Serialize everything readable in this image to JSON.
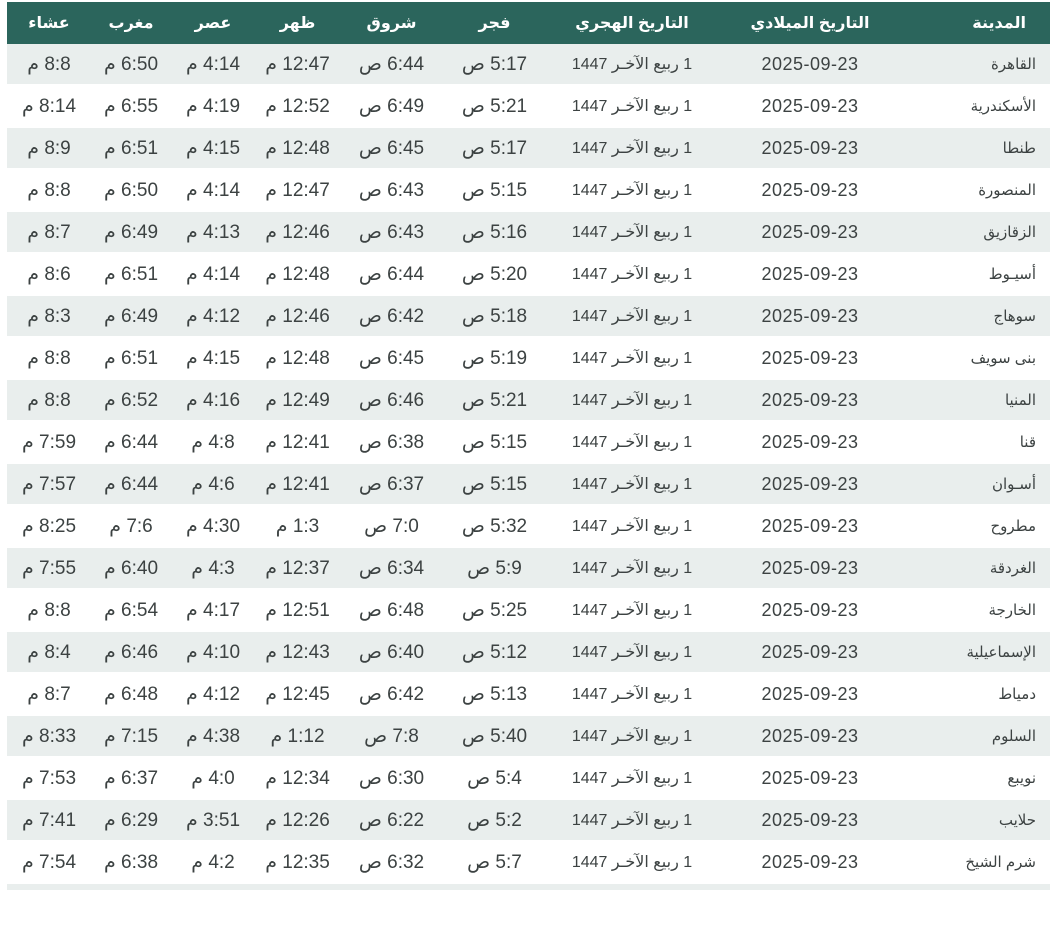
{
  "colors": {
    "header_bg": "#2b655c",
    "header_text": "#ffffff",
    "row_alt_bg": "#e9eeed",
    "row_bg": "#ffffff",
    "text": "#3c4242"
  },
  "table": {
    "field_order": [
      "city",
      "gregorian",
      "hijri",
      "fajr",
      "shuruq",
      "dhuhr",
      "asr",
      "maghrib",
      "isha"
    ],
    "columns": [
      {
        "key": "city",
        "label": "المدينة"
      },
      {
        "key": "gregorian",
        "label": "التاريخ الميلادي"
      },
      {
        "key": "hijri",
        "label": "التاريخ الهجري"
      },
      {
        "key": "fajr",
        "label": "فجر"
      },
      {
        "key": "shuruq",
        "label": "شروق"
      },
      {
        "key": "dhuhr",
        "label": "ظهر"
      },
      {
        "key": "asr",
        "label": "عصر"
      },
      {
        "key": "maghrib",
        "label": "مغرب"
      },
      {
        "key": "isha",
        "label": "عشاء"
      }
    ],
    "rows": [
      {
        "city": "القاهرة",
        "gregorian": "2025-09-23",
        "hijri": "1 ربيع الآخـر 1447",
        "fajr": "5:17 ص",
        "shuruq": "6:44 ص",
        "dhuhr": "12:47 م",
        "asr": "4:14 م",
        "maghrib": "6:50 م",
        "isha": "8:8 م"
      },
      {
        "city": "الأسكندرية",
        "gregorian": "2025-09-23",
        "hijri": "1 ربيع الآخـر 1447",
        "fajr": "5:21 ص",
        "shuruq": "6:49 ص",
        "dhuhr": "12:52 م",
        "asr": "4:19 م",
        "maghrib": "6:55 م",
        "isha": "8:14 م"
      },
      {
        "city": "طنطا",
        "gregorian": "2025-09-23",
        "hijri": "1 ربيع الآخـر 1447",
        "fajr": "5:17 ص",
        "shuruq": "6:45 ص",
        "dhuhr": "12:48 م",
        "asr": "4:15 م",
        "maghrib": "6:51 م",
        "isha": "8:9 م"
      },
      {
        "city": "المنصورة",
        "gregorian": "2025-09-23",
        "hijri": "1 ربيع الآخـر 1447",
        "fajr": "5:15 ص",
        "shuruq": "6:43 ص",
        "dhuhr": "12:47 م",
        "asr": "4:14 م",
        "maghrib": "6:50 م",
        "isha": "8:8 م"
      },
      {
        "city": "الزقازيق",
        "gregorian": "2025-09-23",
        "hijri": "1 ربيع الآخـر 1447",
        "fajr": "5:16 ص",
        "shuruq": "6:43 ص",
        "dhuhr": "12:46 م",
        "asr": "4:13 م",
        "maghrib": "6:49 م",
        "isha": "8:7 م"
      },
      {
        "city": "أسيـوط",
        "gregorian": "2025-09-23",
        "hijri": "1 ربيع الآخـر 1447",
        "fajr": "5:20 ص",
        "shuruq": "6:44 ص",
        "dhuhr": "12:48 م",
        "asr": "4:14 م",
        "maghrib": "6:51 م",
        "isha": "8:6 م"
      },
      {
        "city": "سوهاج",
        "gregorian": "2025-09-23",
        "hijri": "1 ربيع الآخـر 1447",
        "fajr": "5:18 ص",
        "shuruq": "6:42 ص",
        "dhuhr": "12:46 م",
        "asr": "4:12 م",
        "maghrib": "6:49 م",
        "isha": "8:3 م"
      },
      {
        "city": "بنى سويف",
        "gregorian": "2025-09-23",
        "hijri": "1 ربيع الآخـر 1447",
        "fajr": "5:19 ص",
        "shuruq": "6:45 ص",
        "dhuhr": "12:48 م",
        "asr": "4:15 م",
        "maghrib": "6:51 م",
        "isha": "8:8 م"
      },
      {
        "city": "المنيا",
        "gregorian": "2025-09-23",
        "hijri": "1 ربيع الآخـر 1447",
        "fajr": "5:21 ص",
        "shuruq": "6:46 ص",
        "dhuhr": "12:49 م",
        "asr": "4:16 م",
        "maghrib": "6:52 م",
        "isha": "8:8 م"
      },
      {
        "city": "قنا",
        "gregorian": "2025-09-23",
        "hijri": "1 ربيع الآخـر 1447",
        "fajr": "5:15 ص",
        "shuruq": "6:38 ص",
        "dhuhr": "12:41 م",
        "asr": "4:8 م",
        "maghrib": "6:44 م",
        "isha": "7:59 م"
      },
      {
        "city": "أسـوان",
        "gregorian": "2025-09-23",
        "hijri": "1 ربيع الآخـر 1447",
        "fajr": "5:15 ص",
        "shuruq": "6:37 ص",
        "dhuhr": "12:41 م",
        "asr": "4:6 م",
        "maghrib": "6:44 م",
        "isha": "7:57 م"
      },
      {
        "city": "مطروح",
        "gregorian": "2025-09-23",
        "hijri": "1 ربيع الآخـر 1447",
        "fajr": "5:32 ص",
        "shuruq": "7:0 ص",
        "dhuhr": "1:3 م",
        "asr": "4:30 م",
        "maghrib": "7:6 م",
        "isha": "8:25 م"
      },
      {
        "city": "الغردقة",
        "gregorian": "2025-09-23",
        "hijri": "1 ربيع الآخـر 1447",
        "fajr": "5:9 ص",
        "shuruq": "6:34 ص",
        "dhuhr": "12:37 م",
        "asr": "4:3 م",
        "maghrib": "6:40 م",
        "isha": "7:55 م"
      },
      {
        "city": "الخارجة",
        "gregorian": "2025-09-23",
        "hijri": "1 ربيع الآخـر 1447",
        "fajr": "5:25 ص",
        "shuruq": "6:48 ص",
        "dhuhr": "12:51 م",
        "asr": "4:17 م",
        "maghrib": "6:54 م",
        "isha": "8:8 م"
      },
      {
        "city": "الإسماعيلية",
        "gregorian": "2025-09-23",
        "hijri": "1 ربيع الآخـر 1447",
        "fajr": "5:12 ص",
        "shuruq": "6:40 ص",
        "dhuhr": "12:43 م",
        "asr": "4:10 م",
        "maghrib": "6:46 م",
        "isha": "8:4 م"
      },
      {
        "city": "دمياط",
        "gregorian": "2025-09-23",
        "hijri": "1 ربيع الآخـر 1447",
        "fajr": "5:13 ص",
        "shuruq": "6:42 ص",
        "dhuhr": "12:45 م",
        "asr": "4:12 م",
        "maghrib": "6:48 م",
        "isha": "8:7 م"
      },
      {
        "city": "السلوم",
        "gregorian": "2025-09-23",
        "hijri": "1 ربيع الآخـر 1447",
        "fajr": "5:40 ص",
        "shuruq": "7:8 ص",
        "dhuhr": "1:12 م",
        "asr": "4:38 م",
        "maghrib": "7:15 م",
        "isha": "8:33 م"
      },
      {
        "city": "نويبع",
        "gregorian": "2025-09-23",
        "hijri": "1 ربيع الآخـر 1447",
        "fajr": "5:4 ص",
        "shuruq": "6:30 ص",
        "dhuhr": "12:34 م",
        "asr": "4:0 م",
        "maghrib": "6:37 م",
        "isha": "7:53 م"
      },
      {
        "city": "حلايب",
        "gregorian": "2025-09-23",
        "hijri": "1 ربيع الآخـر 1447",
        "fajr": "5:2 ص",
        "shuruq": "6:22 ص",
        "dhuhr": "12:26 م",
        "asr": "3:51 م",
        "maghrib": "6:29 م",
        "isha": "7:41 م"
      },
      {
        "city": "شرم الشيخ",
        "gregorian": "2025-09-23",
        "hijri": "1 ربيع الآخـر 1447",
        "fajr": "5:7 ص",
        "shuruq": "6:32 ص",
        "dhuhr": "12:35 م",
        "asr": "4:2 م",
        "maghrib": "6:38 م",
        "isha": "7:54 م"
      }
    ]
  }
}
